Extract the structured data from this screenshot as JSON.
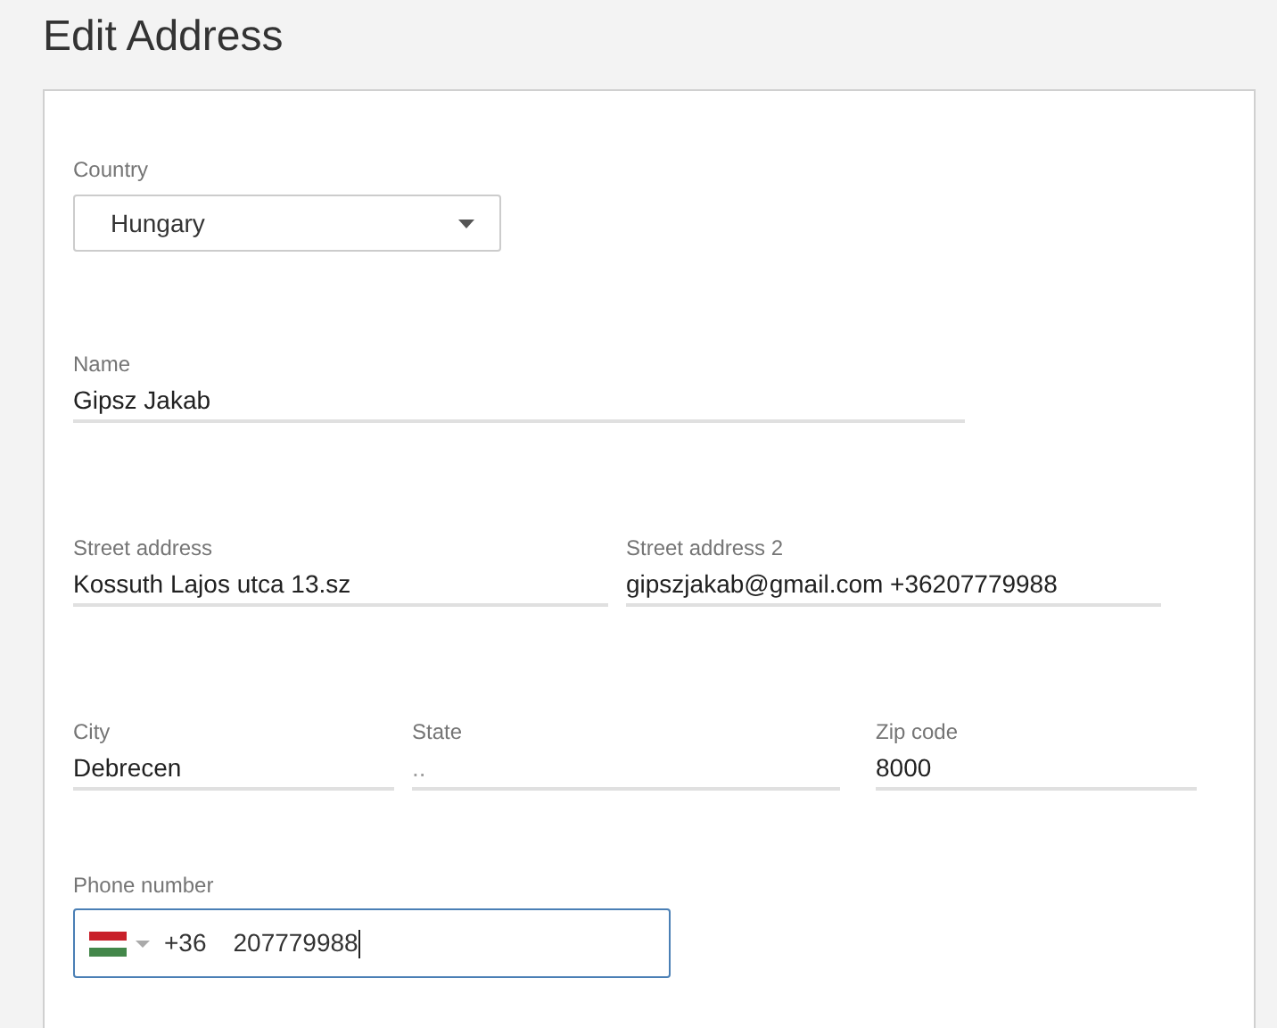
{
  "title": "Edit Address",
  "country": {
    "label": "Country",
    "value": "Hungary"
  },
  "name": {
    "label": "Name",
    "value": "Gipsz Jakab"
  },
  "street_row": [
    {
      "label": "Street address",
      "value": "Kossuth Lajos utca 13.sz"
    },
    {
      "label": "Street address 2",
      "value": "gipszjakab@gmail.com +36207779988"
    }
  ],
  "city_row": [
    {
      "label": "City",
      "value": "Debrecen"
    },
    {
      "label": "State",
      "placeholder": ".."
    },
    {
      "label": "Zip code",
      "value": "8000"
    }
  ],
  "phone": {
    "label": "Phone number",
    "dial_code": "+36",
    "value": "207779988",
    "focused": true
  }
}
